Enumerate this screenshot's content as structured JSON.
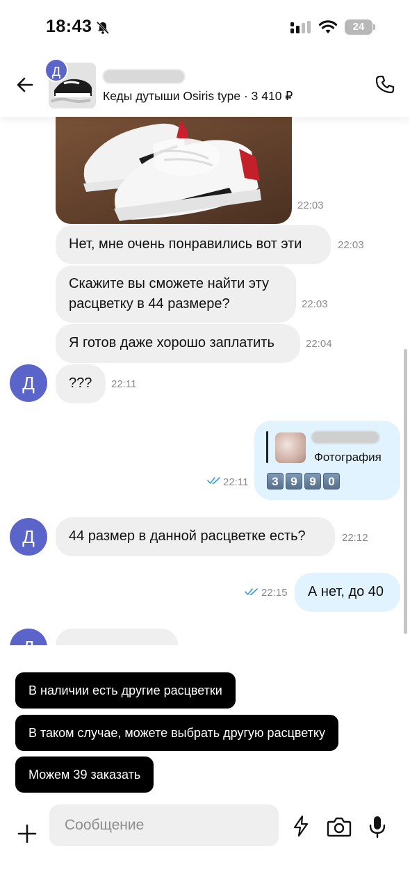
{
  "status_bar": {
    "time": "18:43",
    "battery": "24",
    "icons": [
      "bell-off-icon",
      "signal-icon",
      "wifi-icon",
      "battery-icon"
    ]
  },
  "header": {
    "avatar_letter": "Д",
    "subtitle": "Кеды дутыши Osiris type · 3 410 ₽",
    "icons": [
      "back-arrow-icon",
      "phone-icon"
    ]
  },
  "messages": [
    {
      "type": "image",
      "direction": "in",
      "time": "22:03"
    },
    {
      "direction": "in",
      "text": "Нет, мне очень понравились вот эти",
      "time": "22:03"
    },
    {
      "direction": "in",
      "text": "Скажите вы сможете найти эту расцветку в 44 размере?",
      "time": "22:03"
    },
    {
      "direction": "in",
      "text": "Я готов даже хорошо заплатить",
      "time": "22:04"
    },
    {
      "direction": "in",
      "text": "???",
      "time": "22:11",
      "avatar": "Д"
    },
    {
      "direction": "out",
      "reply_label": "Фотография",
      "digits": [
        "3",
        "9",
        "9",
        "0"
      ],
      "time": "22:11",
      "read": true
    },
    {
      "direction": "in",
      "text": "44 размер в данной расцветке есть?",
      "time": "22:12",
      "avatar": "Д"
    },
    {
      "direction": "out",
      "text": "А нет, до 40",
      "time": "22:15",
      "read": true
    },
    {
      "direction": "in",
      "avatar": "Д",
      "partial": true
    }
  ],
  "quick_replies": [
    "В наличии есть другие расцветки",
    "В таком случае, можете выбрать другую расцветку",
    "Можем 39 заказать"
  ],
  "composer": {
    "placeholder": "Сообщение",
    "icons": [
      "plus-icon",
      "lightning-icon",
      "camera-icon",
      "microphone-icon"
    ]
  },
  "colors": {
    "avatar": "#5b64c9",
    "incoming_bubble": "#efefef",
    "outgoing_bubble": "#e0f3ff",
    "read_check": "#2f9fe0"
  }
}
